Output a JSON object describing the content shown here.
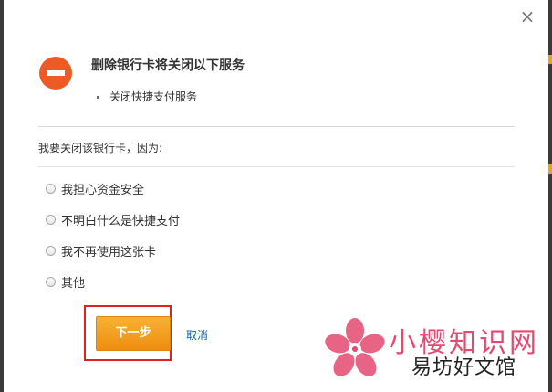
{
  "dialog": {
    "close_glyph": "×",
    "notice": {
      "title": "删除银行卡将关闭以下服务",
      "items": [
        "关闭快捷支付服务"
      ]
    },
    "question": "我要关闭该银行卡，因为:",
    "reasons": [
      "我担心资金安全",
      "不明白什么是快捷支付",
      "我不再使用这张卡",
      "其他"
    ],
    "next_label": "下一步",
    "cancel_label": "取消"
  },
  "watermark": {
    "line1": "小樱知识网",
    "line2": "易坊好文馆"
  },
  "colors": {
    "warning": "#ee5a23",
    "primary_button": "#f39c1a",
    "link": "#1a66b3",
    "highlight": "#e02020",
    "watermark_pink": "#e34a6f"
  },
  "icons": {
    "close": "close-icon",
    "warning": "minus-circle-icon",
    "logo": "sakura-logo-icon"
  }
}
